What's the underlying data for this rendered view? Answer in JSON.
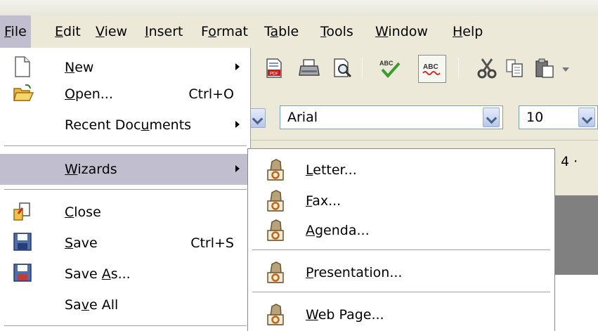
{
  "menubar": {
    "items": [
      {
        "pre": "",
        "key": "F",
        "post": "ile"
      },
      {
        "pre": "",
        "key": "E",
        "post": "dit"
      },
      {
        "pre": "",
        "key": "V",
        "post": "iew"
      },
      {
        "pre": "",
        "key": "I",
        "post": "nsert"
      },
      {
        "pre": "F",
        "key": "o",
        "post": "rmat"
      },
      {
        "pre": "T",
        "key": "a",
        "post": "ble"
      },
      {
        "pre": "",
        "key": "T",
        "post": "ools"
      },
      {
        "pre": "",
        "key": "W",
        "post": "indow"
      },
      {
        "pre": "",
        "key": "H",
        "post": "elp"
      }
    ]
  },
  "toolbar": {
    "font_name": "Arial",
    "font_size": "10"
  },
  "ruler": {
    "text": "4 ·"
  },
  "file_menu": {
    "new": {
      "pre": "",
      "key": "N",
      "post": "ew"
    },
    "open": {
      "pre": "",
      "key": "O",
      "post": "pen...",
      "shortcut": "Ctrl+O"
    },
    "recent": {
      "pre": "Recent Doc",
      "key": "u",
      "post": "ments"
    },
    "wizards": {
      "pre": "",
      "key": "W",
      "post": "izards"
    },
    "close": {
      "pre": "",
      "key": "C",
      "post": "lose"
    },
    "save": {
      "pre": "",
      "key": "S",
      "post": "ave",
      "shortcut": "Ctrl+S"
    },
    "save_as": {
      "pre": "Save ",
      "key": "A",
      "post": "s..."
    },
    "save_all": {
      "pre": "Sa",
      "key": "v",
      "post": "e All"
    }
  },
  "wizards_menu": {
    "letter": {
      "pre": "",
      "key": "L",
      "post": "etter..."
    },
    "fax": {
      "pre": "",
      "key": "F",
      "post": "ax..."
    },
    "agenda": {
      "pre": "",
      "key": "A",
      "post": "genda..."
    },
    "presentation": {
      "pre": "",
      "key": "P",
      "post": "resentation..."
    },
    "web_page": {
      "pre": "",
      "key": "W",
      "post": "eb Page..."
    }
  },
  "icons": {
    "new": "new-document-icon",
    "open": "open-folder-icon",
    "close": "close-document-icon",
    "save": "save-floppy-icon",
    "save_as": "save-as-floppy-icon",
    "wizard": "wizard-hat-icon"
  }
}
